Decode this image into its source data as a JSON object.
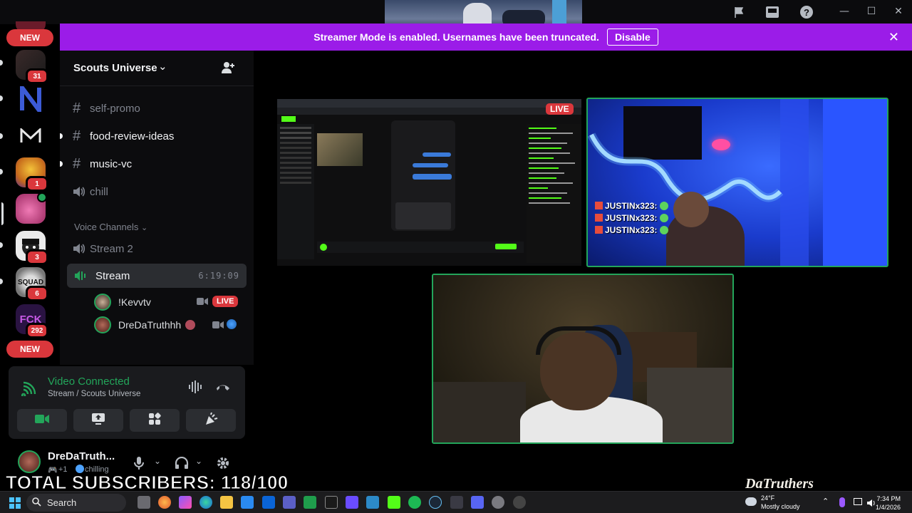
{
  "banner": {
    "message": "Streamer Mode is enabled. Usernames have been truncated.",
    "disable_label": "Disable"
  },
  "rail": {
    "new_top": "NEW",
    "new_bottom": "NEW",
    "badges": [
      "31",
      "1",
      "3",
      "6",
      "292"
    ]
  },
  "server": {
    "name": "Scouts Universe",
    "text_channels": [
      "self-promo",
      "food-review-ideas",
      "music-vc"
    ],
    "voice_channel_chill": "chill",
    "voice_category": "Voice Channels",
    "voice_channels": [
      "Stream 2",
      "Stream"
    ],
    "stream_elapsed": "6:19:09",
    "voice_users": [
      {
        "name": "!Kevvtv",
        "badge": "LIVE"
      },
      {
        "name": "DreDaTruthhh"
      }
    ]
  },
  "voice_panel": {
    "status": "Video Connected",
    "location": "Stream / Scouts Universe"
  },
  "user_panel": {
    "name": "DreDaTruth...",
    "status": "chilling",
    "extra": "+1"
  },
  "stream": {
    "live_label": "LIVE",
    "chat_lines": [
      "JUSTINx323:",
      "JUSTINx323:",
      "JUSTINx323:"
    ]
  },
  "overlay": {
    "subscribers": "TOTAL SUBSCRIBERS: 118/100",
    "watermark": "DaTruthers"
  },
  "taskbar": {
    "search_label": "Search",
    "temperature": "24°F",
    "weather": "Mostly cloudy",
    "time": "7:34 PM",
    "date": "1/4/2026"
  },
  "colors": {
    "banner": "#9b1ce8",
    "live": "#da373c",
    "connected": "#23a55a",
    "speaking_border": "#23a55a"
  },
  "icons": [
    "flag-icon",
    "inbox-icon",
    "help-icon",
    "invite-icon",
    "hash-icon",
    "speaker-icon",
    "stream-icon",
    "camera-icon",
    "screenshare-icon",
    "activities-icon",
    "soundboard-icon",
    "disconnect-icon",
    "mic-icon",
    "headset-icon",
    "settings-icon",
    "windows-icon",
    "search-icon"
  ]
}
